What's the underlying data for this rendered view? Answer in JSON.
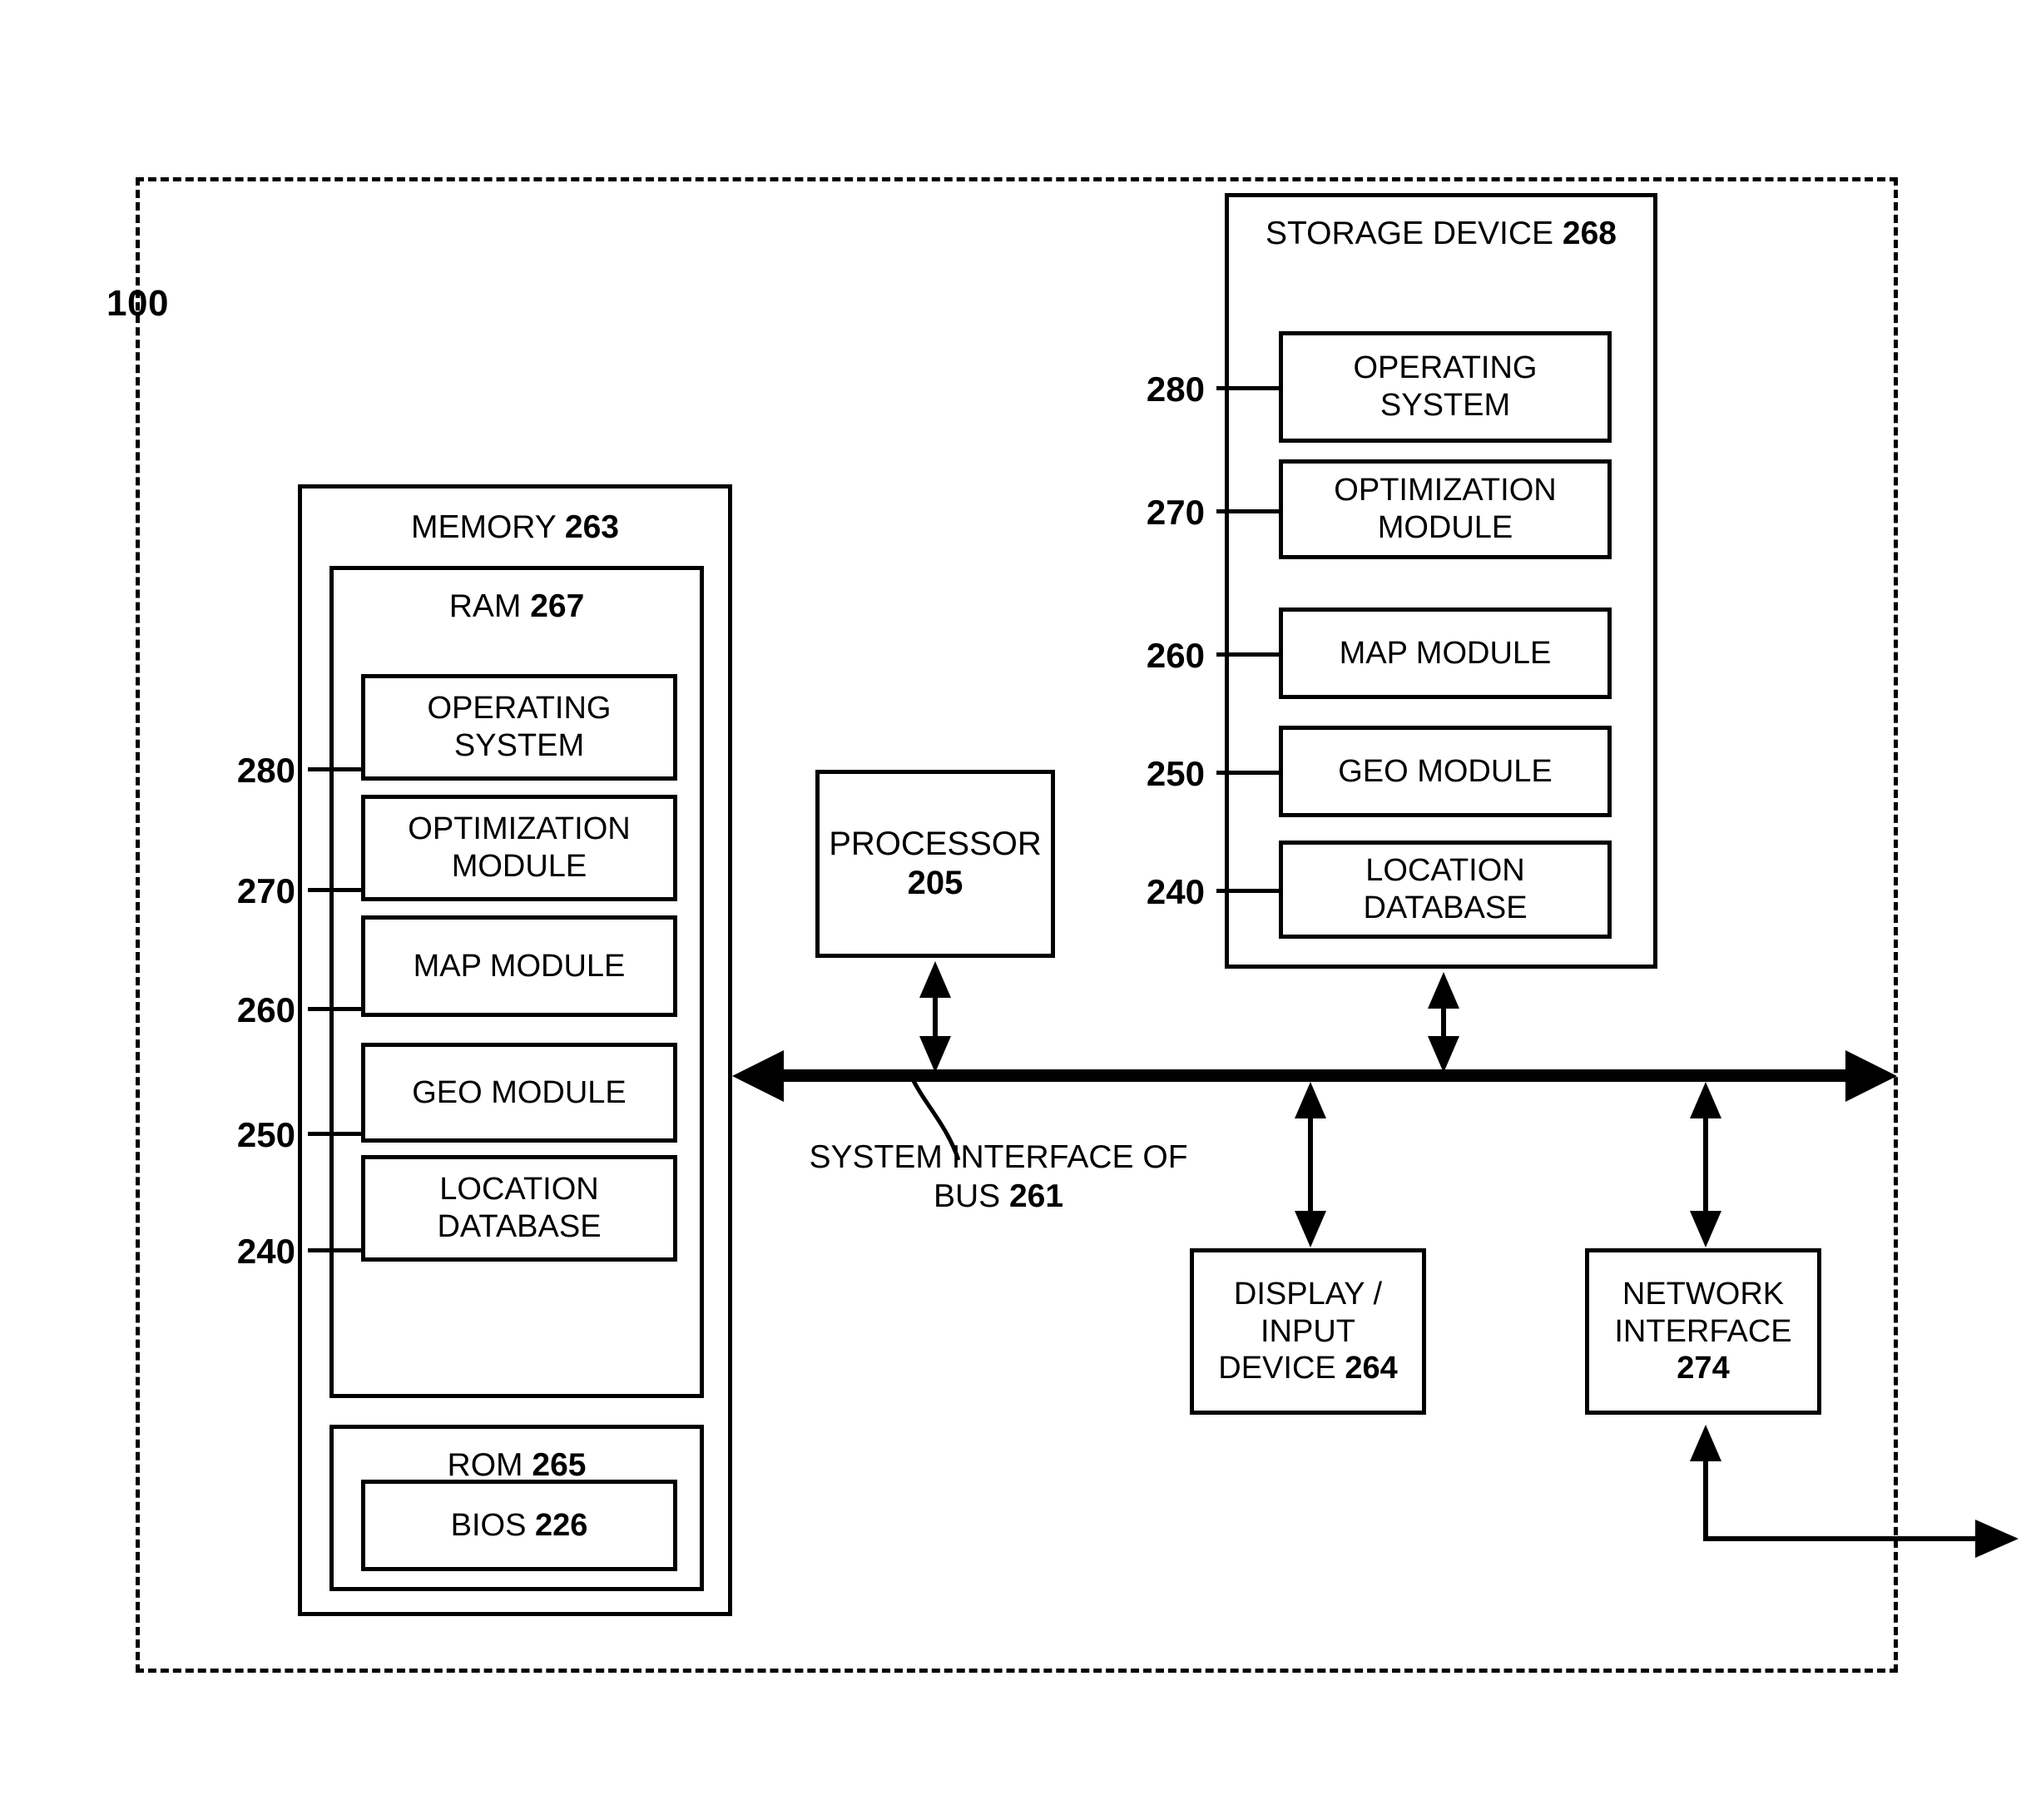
{
  "figure": {
    "system_ref": "100",
    "bus_label_line1": "SYSTEM INTERFACE OF",
    "bus_label_line2": "BUS",
    "bus_ref": "261"
  },
  "memory": {
    "title": "MEMORY",
    "ref": "263",
    "ram": {
      "title": "RAM",
      "ref": "267",
      "items": [
        {
          "label": "OPERATING\nSYSTEM",
          "line1": "OPERATING",
          "line2": "SYSTEM",
          "ref": "280"
        },
        {
          "label": "OPTIMIZATION\nMODULE",
          "line1": "OPTIMIZATION",
          "line2": "MODULE",
          "ref": "270"
        },
        {
          "label": "MAP MODULE",
          "line1": "MAP MODULE",
          "line2": "",
          "ref": "260"
        },
        {
          "label": "GEO MODULE",
          "line1": "GEO MODULE",
          "line2": "",
          "ref": "250"
        },
        {
          "label": "LOCATION\nDATABASE",
          "line1": "LOCATION",
          "line2": "DATABASE",
          "ref": "240"
        }
      ]
    },
    "rom": {
      "title": "ROM",
      "ref": "265",
      "bios": {
        "title": "BIOS",
        "ref": "226"
      }
    }
  },
  "storage": {
    "title": "STORAGE DEVICE",
    "ref": "268",
    "items": [
      {
        "line1": "OPERATING",
        "line2": "SYSTEM",
        "ref": "280"
      },
      {
        "line1": "OPTIMIZATION",
        "line2": "MODULE",
        "ref": "270"
      },
      {
        "line1": "MAP MODULE",
        "line2": "",
        "ref": "260"
      },
      {
        "line1": "GEO MODULE",
        "line2": "",
        "ref": "250"
      },
      {
        "line1": "LOCATION",
        "line2": "DATABASE",
        "ref": "240"
      }
    ]
  },
  "processor": {
    "line1": "PROCESSOR",
    "ref": "205"
  },
  "display_input": {
    "line1": "DISPLAY /",
    "line2": "INPUT",
    "line3": "DEVICE",
    "ref": "264"
  },
  "network_interface": {
    "line1": "NETWORK",
    "line2": "INTERFACE",
    "ref": "274"
  },
  "colors": {
    "stroke": "#000000",
    "background": "#ffffff"
  }
}
